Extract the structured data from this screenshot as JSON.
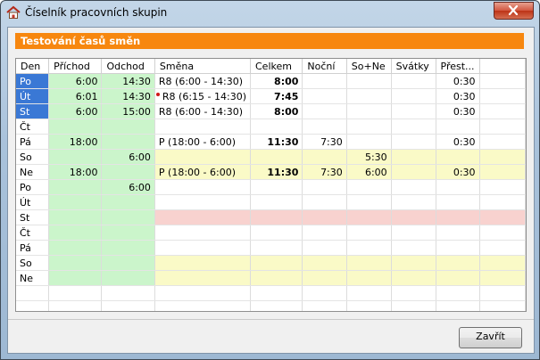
{
  "window": {
    "title": "Číselník pracovních skupin",
    "close_label": "✕"
  },
  "section": {
    "title": "Testování časů směn"
  },
  "grid": {
    "columns": [
      "Den",
      "Příchod",
      "Odchod",
      "Směna",
      "Celkem",
      "Noční",
      "So+Ne",
      "Svátky",
      "Přest..."
    ],
    "rows": [
      {
        "den": "Po",
        "prichod": "6:00",
        "odchod": "14:30",
        "smena": "R8 (6:00 - 14:30)",
        "celkem": "8:00",
        "nocni": "",
        "sone": "",
        "svatky": "",
        "prestavka": "0:30"
      },
      {
        "den": "Út",
        "prichod": "6:01",
        "odchod": "14:30",
        "smena": "R8 (6:15 - 14:30)",
        "celkem": "7:45",
        "nocni": "",
        "sone": "",
        "svatky": "",
        "prestavka": "0:30"
      },
      {
        "den": "St",
        "prichod": "6:00",
        "odchod": "15:00",
        "smena": "R8 (6:00 - 14:30)",
        "celkem": "8:00",
        "nocni": "",
        "sone": "",
        "svatky": "",
        "prestavka": "0:30"
      },
      {
        "den": "Čt",
        "prichod": "",
        "odchod": "",
        "smena": "",
        "celkem": "",
        "nocni": "",
        "sone": "",
        "svatky": "",
        "prestavka": ""
      },
      {
        "den": "Pá",
        "prichod": "18:00",
        "odchod": "",
        "smena": "P (18:00 - 6:00)",
        "celkem": "11:30",
        "nocni": "7:30",
        "sone": "",
        "svatky": "",
        "prestavka": "0:30"
      },
      {
        "den": "So",
        "prichod": "",
        "odchod": "6:00",
        "smena": "",
        "celkem": "",
        "nocni": "",
        "sone": "5:30",
        "svatky": "",
        "prestavka": ""
      },
      {
        "den": "Ne",
        "prichod": "18:00",
        "odchod": "",
        "smena": "P (18:00 - 6:00)",
        "celkem": "11:30",
        "nocni": "7:30",
        "sone": "6:00",
        "svatky": "",
        "prestavka": "0:30"
      },
      {
        "den": "Po",
        "prichod": "",
        "odchod": "6:00",
        "smena": "",
        "celkem": "",
        "nocni": "",
        "sone": "",
        "svatky": "",
        "prestavka": ""
      },
      {
        "den": "Út",
        "prichod": "",
        "odchod": "",
        "smena": "",
        "celkem": "",
        "nocni": "",
        "sone": "",
        "svatky": "",
        "prestavka": ""
      },
      {
        "den": "St",
        "prichod": "",
        "odchod": "",
        "smena": "",
        "celkem": "",
        "nocni": "",
        "sone": "",
        "svatky": "",
        "prestavka": ""
      },
      {
        "den": "Čt",
        "prichod": "",
        "odchod": "",
        "smena": "",
        "celkem": "",
        "nocni": "",
        "sone": "",
        "svatky": "",
        "prestavka": ""
      },
      {
        "den": "Pá",
        "prichod": "",
        "odchod": "",
        "smena": "",
        "celkem": "",
        "nocni": "",
        "sone": "",
        "svatky": "",
        "prestavka": ""
      },
      {
        "den": "So",
        "prichod": "",
        "odchod": "",
        "smena": "",
        "celkem": "",
        "nocni": "",
        "sone": "",
        "svatky": "",
        "prestavka": ""
      },
      {
        "den": "Ne",
        "prichod": "",
        "odchod": "",
        "smena": "",
        "celkem": "",
        "nocni": "",
        "sone": "",
        "svatky": "",
        "prestavka": ""
      }
    ]
  },
  "footer": {
    "close_button": "Zavřít"
  },
  "colors": {
    "accent": "#f7870f",
    "green": "#cbf5cb",
    "yellow": "#fafac7",
    "pink": "#f8d2cf",
    "selection": "#3a78d5"
  }
}
